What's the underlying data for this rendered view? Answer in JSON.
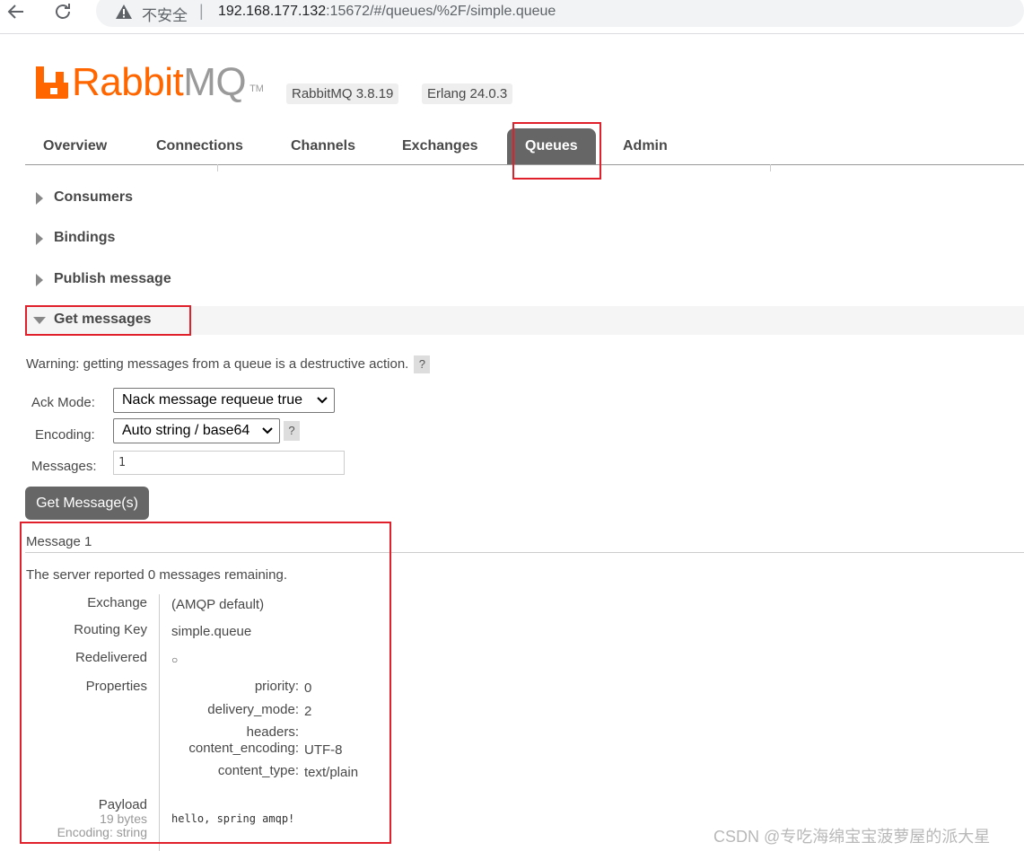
{
  "browser": {
    "back_icon": "arrow-left-icon",
    "reload_icon": "reload-icon",
    "warning_icon": "warning-triangle-icon",
    "insecure_label": "不安全",
    "separator": "|",
    "url_host": "192.168.177.132",
    "url_rest": ":15672/#/queues/%2F/simple.queue"
  },
  "header": {
    "logo_rabbit": "Rabbit",
    "logo_mq": "MQ",
    "logo_tm": "TM",
    "version_badge": "RabbitMQ 3.8.19",
    "erlang_badge": "Erlang 24.0.3",
    "brand_color": "#ff6600"
  },
  "tabs": [
    {
      "label": "Overview"
    },
    {
      "label": "Connections"
    },
    {
      "label": "Channels"
    },
    {
      "label": "Exchanges"
    },
    {
      "label": "Queues",
      "active": true
    },
    {
      "label": "Admin"
    }
  ],
  "sections": {
    "consumers": "Consumers",
    "bindings": "Bindings",
    "publish": "Publish message",
    "get_messages": "Get messages"
  },
  "get_form": {
    "warning": "Warning: getting messages from a queue is a destructive action.",
    "help": "?",
    "ack_mode_label": "Ack Mode:",
    "ack_mode_value": "Nack message requeue true",
    "encoding_label": "Encoding:",
    "encoding_value": "Auto string / base64",
    "messages_label": "Messages:",
    "messages_value": "1",
    "button": "Get Message(s)"
  },
  "message": {
    "title": "Message 1",
    "reported_prefix": "The server reported ",
    "remaining_count": "0",
    "reported_suffix": " messages remaining.",
    "exchange_label": "Exchange",
    "exchange_value": "(AMQP default)",
    "routing_key_label": "Routing Key",
    "routing_key_value": "simple.queue",
    "redelivered_label": "Redelivered",
    "redelivered_value": "○",
    "properties_label": "Properties",
    "properties": {
      "priority_label": "priority:",
      "priority_value": "0",
      "delivery_mode_label": "delivery_mode:",
      "delivery_mode_value": "2",
      "headers_label": "headers:",
      "content_encoding_label": "content_encoding:",
      "content_encoding_value": "UTF-8",
      "content_type_label": "content_type:",
      "content_type_value": "text/plain"
    },
    "payload_label": "Payload",
    "payload_size": "19 bytes",
    "payload_encoding": "Encoding: string",
    "payload_value": "hello, spring amqp!"
  },
  "watermark": "CSDN @专吃海绵宝宝菠萝屋的派大星",
  "annotation_color": "#e0212b"
}
